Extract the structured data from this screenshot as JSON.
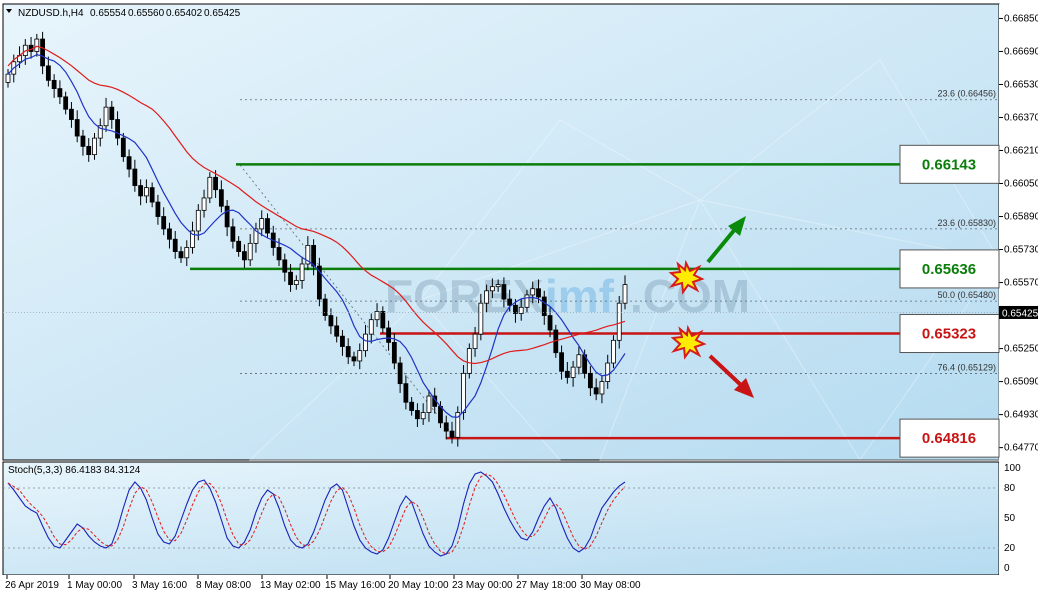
{
  "window": {
    "symbol_header": "NZDUSD.h,H4",
    "ohlc": [
      "0.65554",
      "0.65560",
      "0.65402",
      "0.65425"
    ]
  },
  "colors": {
    "background_light": "#dff0fa",
    "background_mid": "#b9def2",
    "up_candle": "#ffffff",
    "down_candle": "#000000",
    "ma_fast": "#1f33c8",
    "ma_slow": "#e01b1b",
    "resistance": "#0a7d0a",
    "support": "#c81414",
    "stoch_main": "#1a23b8",
    "stoch_signal": "#e01b1b"
  },
  "watermark": {
    "part1": "FOREX",
    "part2": "imf",
    "part3": ".COM"
  },
  "price_axis": {
    "ticks": [
      "0.66850",
      "0.66690",
      "0.66530",
      "0.66370",
      "0.66210",
      "0.66050",
      "0.65890",
      "0.65730",
      "0.65570",
      "0.65410",
      "0.65250",
      "0.65090",
      "0.64930",
      "0.64770"
    ],
    "current_price": "0.65425"
  },
  "time_axis": {
    "labels": [
      "26 Apr 2019",
      "1 May 00:00",
      "3 May 16:00",
      "8 May 08:00",
      "13 May 02:00",
      "15 May 16:00",
      "20 May 10:00",
      "23 May 00:00",
      "27 May 18:00",
      "30 May 08:00"
    ]
  },
  "fibonacci": [
    {
      "label": "23.6 (0.66456)",
      "price": 0.66456
    },
    {
      "label": "23.6 (0.65830)",
      "price": 0.6583
    },
    {
      "label": "50.0 (0.65480)",
      "price": 0.6548
    },
    {
      "label": "76.4 (0.65129)",
      "price": 0.65129
    }
  ],
  "levels": [
    {
      "label": "0.66143",
      "price": 0.66143,
      "color": "green"
    },
    {
      "label": "0.65636",
      "price": 0.65636,
      "color": "green"
    },
    {
      "label": "0.65323",
      "price": 0.65323,
      "color": "red"
    },
    {
      "label": "0.64816",
      "price": 0.64816,
      "color": "red"
    }
  ],
  "stochastic": {
    "header": "Stoch(5,3,3) 86.4183 84.3124",
    "ticks": [
      "100",
      "80",
      "50",
      "20",
      "0"
    ]
  },
  "chart_data": {
    "type": "candlestick",
    "symbol": "NZDUSD",
    "timeframe": "H4",
    "ylim": [
      0.6471,
      0.6692
    ],
    "close": [
      0.6658,
      0.6664,
      0.6667,
      0.6672,
      0.6669,
      0.6675,
      0.6662,
      0.6655,
      0.6651,
      0.6647,
      0.6641,
      0.6636,
      0.6628,
      0.6623,
      0.6619,
      0.6627,
      0.6633,
      0.6642,
      0.6636,
      0.6627,
      0.6618,
      0.6612,
      0.6604,
      0.6599,
      0.6603,
      0.6596,
      0.6589,
      0.6583,
      0.6578,
      0.6572,
      0.6569,
      0.6574,
      0.6582,
      0.6592,
      0.6598,
      0.6608,
      0.6602,
      0.6594,
      0.6584,
      0.6577,
      0.6572,
      0.6568,
      0.6576,
      0.6583,
      0.6588,
      0.6581,
      0.6574,
      0.6568,
      0.6562,
      0.6556,
      0.6558,
      0.6566,
      0.6575,
      0.6565,
      0.6549,
      0.6541,
      0.6536,
      0.6531,
      0.6526,
      0.6521,
      0.6519,
      0.6524,
      0.6532,
      0.6539,
      0.6543,
      0.6535,
      0.6528,
      0.6518,
      0.6508,
      0.6499,
      0.6495,
      0.6491,
      0.6494,
      0.6502,
      0.6497,
      0.6489,
      0.6485,
      0.6482,
      0.6494,
      0.6513,
      0.6525,
      0.6532,
      0.6547,
      0.6553,
      0.6555,
      0.6556,
      0.6549,
      0.6546,
      0.6542,
      0.6545,
      0.6551,
      0.6554,
      0.655,
      0.6541,
      0.6534,
      0.6523,
      0.6514,
      0.6511,
      0.6516,
      0.6522,
      0.6513,
      0.6506,
      0.6503,
      0.6509,
      0.6518,
      0.6529,
      0.6547,
      0.6556
    ],
    "ma_fast_period_note": "",
    "stoch_k": [
      85,
      78,
      70,
      62,
      58,
      55,
      42,
      30,
      22,
      20,
      28,
      36,
      44,
      40,
      32,
      26,
      22,
      20,
      24,
      40,
      60,
      78,
      86,
      80,
      68,
      50,
      34,
      26,
      24,
      32,
      48,
      64,
      78,
      86,
      88,
      80,
      66,
      48,
      30,
      22,
      20,
      26,
      38,
      56,
      70,
      78,
      74,
      60,
      42,
      28,
      22,
      20,
      24,
      36,
      52,
      68,
      80,
      84,
      78,
      60,
      42,
      28,
      20,
      16,
      14,
      18,
      30,
      46,
      62,
      72,
      66,
      50,
      34,
      22,
      16,
      12,
      14,
      22,
      40,
      64,
      84,
      94,
      96,
      92,
      86,
      74,
      60,
      48,
      38,
      30,
      28,
      36,
      50,
      62,
      70,
      60,
      44,
      30,
      20,
      16,
      20,
      30,
      46,
      60,
      68,
      76,
      82,
      86
    ]
  }
}
